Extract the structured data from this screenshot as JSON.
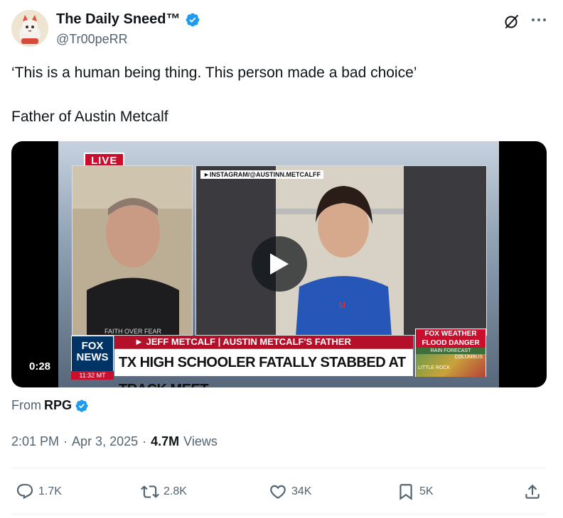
{
  "author": {
    "display_name": "The Daily Sneed™",
    "handle": "@Tr00peRR",
    "verified": true
  },
  "tweet": {
    "lines": [
      "‘This is a human being thing. This person made a bad choice’",
      "Father of Austin Metcalf"
    ]
  },
  "video": {
    "duration": "0:28",
    "overlay": {
      "live_label": "LIVE",
      "instagram_tag": "►INSTAGRAM/@AUSTINN.METCALFF",
      "shirt_text": "FAITH OVER FEAR",
      "name_strip": "► JEFF METCALF | AUSTIN METCALF'S FATHER",
      "headline": "TX HIGH SCHOOLER FATALLY STABBED AT TRACK MEET",
      "network_logo": "FOX NEWS",
      "network_time": "11:32 MT",
      "weather_brand": "FOX WEATHER",
      "weather_alert": "FLOOD DANGER",
      "weather_sub": "RAIN FORECAST",
      "weather_city_1": "COLUMBUS",
      "weather_city_2": "LITTLE ROCK"
    }
  },
  "source": {
    "prefix": "From",
    "name": "RPG",
    "verified": true
  },
  "meta": {
    "time": "2:01 PM",
    "separator": "·",
    "date": "Apr 3, 2025",
    "views_count": "4.7M",
    "views_label": "Views"
  },
  "actions": {
    "replies": "1.7K",
    "reposts": "2.8K",
    "likes": "34K",
    "bookmarks": "5K"
  },
  "icons": {
    "verified": "verified-badge-icon",
    "grok": "grok-icon",
    "more": "more-icon",
    "reply": "reply-icon",
    "repost": "repost-icon",
    "like": "heart-icon",
    "bookmark": "bookmark-icon",
    "share": "share-icon",
    "play": "play-icon"
  },
  "colors": {
    "verified_blue": "#1d9bf0",
    "text_primary": "#0f1419",
    "text_secondary": "#536471",
    "fox_red": "#c8102e",
    "fox_blue": "#003366"
  }
}
